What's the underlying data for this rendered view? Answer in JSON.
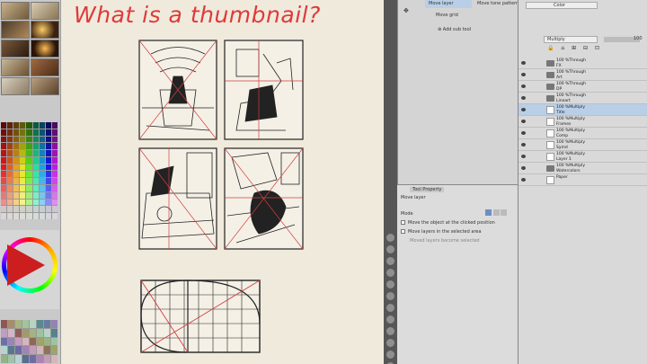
{
  "canvas": {
    "title": "What is a thumbnail?"
  },
  "tool_panel": {
    "subtools": [
      "Move layer",
      "Move tone pattern",
      "Move grid"
    ],
    "add_sub_tool": "Add sub tool",
    "color_label": "Color"
  },
  "tool_property": {
    "tab": "Tool Property",
    "header": "Move layer",
    "mode_label": "Mode",
    "options": [
      "Move the object at the clicked position",
      "Move layers in the selected area",
      "Moved layers become selected"
    ]
  },
  "layer_panel": {
    "blend_mode": "Multiply",
    "opacity": "100",
    "layers": [
      {
        "name": "100 %Through\nFX",
        "type": "folder"
      },
      {
        "name": "100 %Through\nArt",
        "type": "folder"
      },
      {
        "name": "100 %Through\nDP",
        "type": "folder"
      },
      {
        "name": "100 %Through\nLineart",
        "type": "folder"
      },
      {
        "name": "100 %Multiply\nTitle",
        "type": "layer",
        "selected": true
      },
      {
        "name": "100 %Multiply\nFrames",
        "type": "layer"
      },
      {
        "name": "100 %Multiply\nComp",
        "type": "layer"
      },
      {
        "name": "100 %Multiply\nSymd",
        "type": "layer"
      },
      {
        "name": "100 %Multiply\nLayer 1",
        "type": "layer"
      },
      {
        "name": "100 %Multiply\nWatercolors",
        "type": "folder"
      },
      {
        "name": "Paper",
        "type": "layer"
      }
    ]
  },
  "colors": {
    "title_red": "#e03a3a",
    "selection_blue": "#b9cfe8"
  }
}
